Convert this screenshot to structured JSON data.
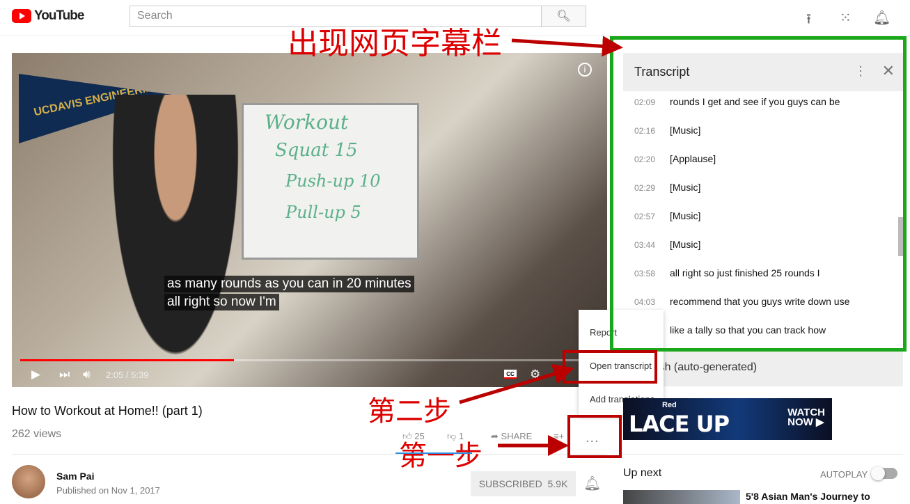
{
  "masthead": {
    "logo": "YouTube",
    "search_placeholder": "Search",
    "icons": [
      "upload-icon",
      "apps-icon",
      "notifications-icon"
    ]
  },
  "player": {
    "subtitle_line1": "as many rounds as you can in 20 minutes",
    "subtitle_line2": "all right so now I'm",
    "time": "2:05 / 5:39",
    "progress": 0.37,
    "whiteboard": [
      "Workout",
      "Squat 15",
      "Push-up 10",
      "Pull-up 5"
    ],
    "pennant": "UCDAVIS ENGINEERING"
  },
  "video": {
    "title": "How to Workout at Home!! (part 1)",
    "views": "262 views",
    "likes": "25",
    "dislikes": "1",
    "share": "SHARE",
    "more": "..."
  },
  "channel": {
    "name": "Sam Pai",
    "published": "Published on Nov 1, 2017",
    "subscribe": "SUBSCRIBED",
    "subscribers": "5.9K"
  },
  "transcript": {
    "title": "Transcript",
    "language": "English (auto-generated)",
    "rows": [
      {
        "t": "02:09",
        "text": "rounds I get and see if you guys can be"
      },
      {
        "t": "02:16",
        "text": "[Music]"
      },
      {
        "t": "02:20",
        "text": "[Applause]"
      },
      {
        "t": "02:29",
        "text": "[Music]"
      },
      {
        "t": "02:57",
        "text": "[Music]"
      },
      {
        "t": "03:44",
        "text": "[Music]"
      },
      {
        "t": "03:58",
        "text": "all right so just finished 25 rounds I"
      },
      {
        "t": "04:03",
        "text": "recommend that you guys write down use"
      },
      {
        "t": "",
        "text": "like a tally so that you can track how"
      }
    ]
  },
  "menu": {
    "items": [
      "Report",
      "Open transcript",
      "Add translations"
    ]
  },
  "ad": {
    "brand": "Red",
    "headline": "LACE UP",
    "cta1": "WATCH",
    "cta2": "NOW"
  },
  "sidebar": {
    "up_next": "Up next",
    "autoplay": "AUTOPLAY",
    "autoplay_on": false,
    "next_title": "5'8 Asian Man's Journey to"
  },
  "annotations": {
    "top": "出现网页字幕栏",
    "step2": "第二步",
    "step1": "第一步",
    "color": "#cc0000",
    "panel_color": "#1aa81a"
  }
}
